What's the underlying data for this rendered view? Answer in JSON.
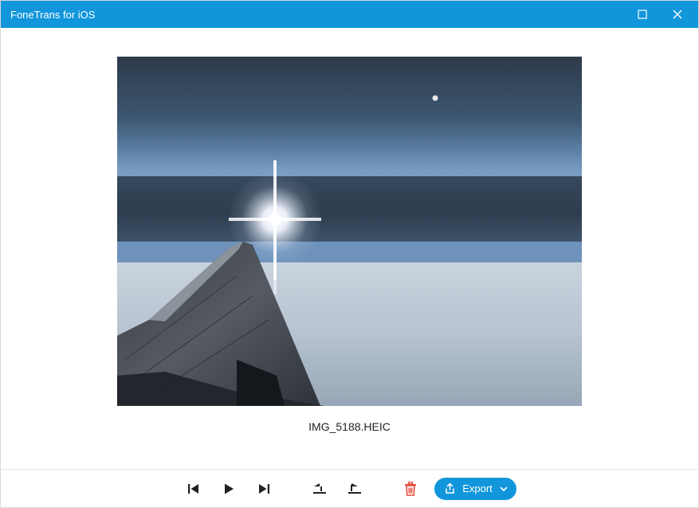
{
  "window": {
    "title": "FoneTrans for iOS"
  },
  "image": {
    "filename": "IMG_5188.HEIC"
  },
  "toolbar": {
    "export_label": "Export"
  }
}
